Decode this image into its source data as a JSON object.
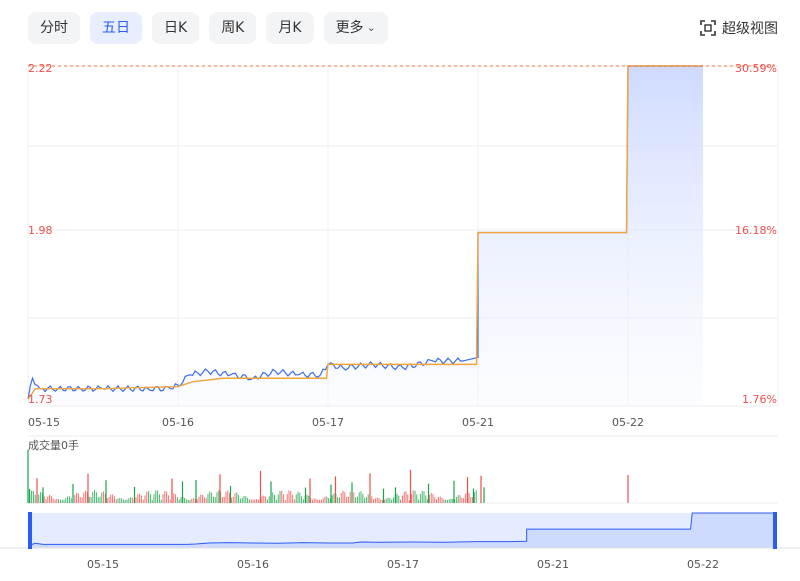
{
  "tabs": [
    {
      "label": "分时",
      "active": false
    },
    {
      "label": "五日",
      "active": true
    },
    {
      "label": "日K",
      "active": false
    },
    {
      "label": "周K",
      "active": false
    },
    {
      "label": "月K",
      "active": false
    },
    {
      "label": "更多",
      "active": false
    }
  ],
  "fullscreen_label": "超级视图",
  "volume_label": "成交量0手",
  "colors": {
    "price_line": "#3a6ee8",
    "avg_line": "#f0a43a",
    "up": "#f04e4e",
    "down": "#1aa34a",
    "accent": "#2c5cf0"
  },
  "chart_data": {
    "type": "line",
    "title": "",
    "xlabel": "",
    "ylabel": "",
    "categories": [
      "05-15",
      "05-16",
      "05-17",
      "05-21",
      "05-22"
    ],
    "ylim": [
      1.73,
      2.22
    ],
    "y_ticks_left": [
      "2.22",
      "1.98",
      "1.73"
    ],
    "y_ticks_right": [
      "30.59%",
      "16.18%",
      "1.76%"
    ],
    "reference_price": 2.22,
    "series": [
      {
        "key": "price",
        "points": [
          [
            0.0,
            1.74
          ],
          [
            0.03,
            1.77
          ],
          [
            0.08,
            1.755
          ],
          [
            0.2,
            1.755
          ],
          [
            0.35,
            1.755
          ],
          [
            0.5,
            1.755
          ],
          [
            0.65,
            1.755
          ],
          [
            0.8,
            1.755
          ],
          [
            0.95,
            1.755
          ],
          [
            1.0,
            1.76
          ],
          [
            1.08,
            1.775
          ],
          [
            1.2,
            1.78
          ],
          [
            1.35,
            1.775
          ],
          [
            1.5,
            1.77
          ],
          [
            1.65,
            1.78
          ],
          [
            1.8,
            1.775
          ],
          [
            1.95,
            1.775
          ],
          [
            2.0,
            1.79
          ],
          [
            2.1,
            1.785
          ],
          [
            2.3,
            1.79
          ],
          [
            2.5,
            1.785
          ],
          [
            2.7,
            1.795
          ],
          [
            2.9,
            1.795
          ],
          [
            3.0,
            1.8
          ],
          [
            3.0,
            1.98
          ],
          [
            3.5,
            1.98
          ],
          [
            3.99,
            1.98
          ],
          [
            4.0,
            2.22
          ],
          [
            4.5,
            2.22
          ]
        ]
      },
      {
        "key": "average",
        "points": [
          [
            0.0,
            1.74
          ],
          [
            0.05,
            1.755
          ],
          [
            0.5,
            1.755
          ],
          [
            1.0,
            1.758
          ],
          [
            1.1,
            1.765
          ],
          [
            1.3,
            1.77
          ],
          [
            1.99,
            1.77
          ],
          [
            2.0,
            1.79
          ],
          [
            2.99,
            1.79
          ],
          [
            3.0,
            1.98
          ],
          [
            3.99,
            1.98
          ],
          [
            4.0,
            2.22
          ],
          [
            4.5,
            2.22
          ]
        ]
      }
    ],
    "volume": {
      "up_bars": [
        0.06,
        0.4,
        0.96,
        1.28,
        1.55,
        1.88,
        2.05,
        2.28,
        2.55,
        2.93,
        3.02,
        4.0
      ],
      "down_bars": [
        0.01,
        0.1,
        0.3,
        0.52,
        0.71,
        1.03,
        1.12,
        1.35,
        1.62,
        1.85,
        2.02,
        2.16,
        2.37,
        2.45,
        2.67,
        2.84,
        2.97,
        3.04
      ]
    },
    "navigator_categories": [
      "05-15",
      "05-16",
      "05-17",
      "05-21",
      "05-22"
    ]
  }
}
